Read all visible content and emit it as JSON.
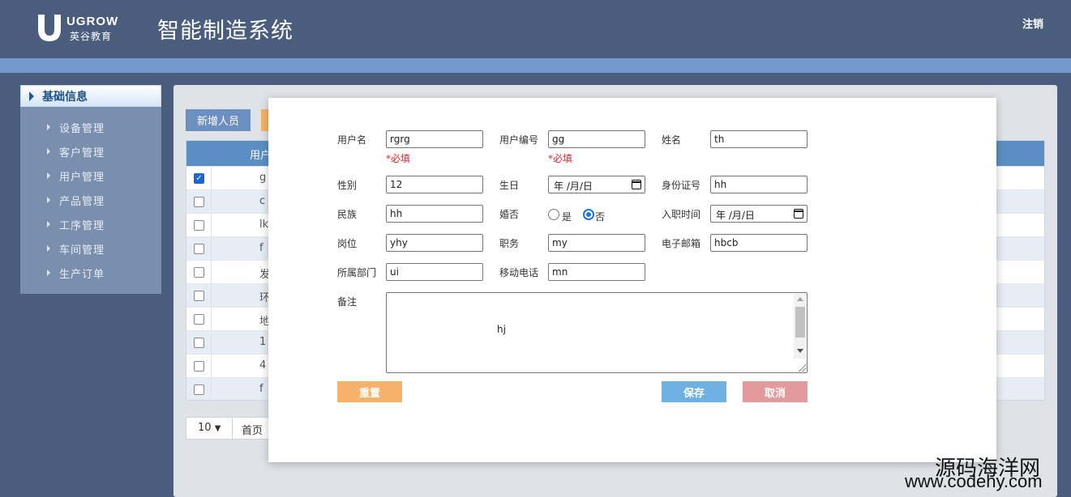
{
  "header": {
    "logo_en": "UGROW",
    "logo_cn": "英谷教育",
    "title": "智能制造系统",
    "logout": "注销"
  },
  "sidebar": {
    "group_label": "基础信息",
    "items": [
      {
        "label": "设备管理"
      },
      {
        "label": "客户管理"
      },
      {
        "label": "用户管理"
      },
      {
        "label": "产品管理"
      },
      {
        "label": "工序管理"
      },
      {
        "label": "车间管理"
      },
      {
        "label": "生产订单"
      }
    ]
  },
  "main": {
    "add_button": "新增人员",
    "table_header": "用户",
    "rows": [
      {
        "checked": true,
        "text": "g"
      },
      {
        "checked": false,
        "text": "c"
      },
      {
        "checked": false,
        "text": "lk"
      },
      {
        "checked": false,
        "text": "f"
      },
      {
        "checked": false,
        "text": "发"
      },
      {
        "checked": false,
        "text": "环"
      },
      {
        "checked": false,
        "text": "地"
      },
      {
        "checked": false,
        "text": "1"
      },
      {
        "checked": false,
        "text": "4"
      },
      {
        "checked": false,
        "text": "f"
      }
    ],
    "pager": {
      "page_size": "10",
      "first": "首页"
    }
  },
  "modal": {
    "labels": {
      "username": "用户名",
      "user_no": "用户编号",
      "name": "姓名",
      "gender": "性别",
      "birthday": "生日",
      "id_card": "身份证号",
      "ethnicity": "民族",
      "marital": "婚否",
      "hire_date": "入职时间",
      "post": "岗位",
      "duty": "职务",
      "email": "电子邮箱",
      "department": "所属部门",
      "mobile": "移动电话",
      "remark": "备注"
    },
    "values": {
      "username": "rgrg",
      "user_no": "gg",
      "name": "th",
      "gender": "12",
      "birthday": "年 /月/日",
      "id_card": "hh",
      "ethnicity": "hh",
      "hire_date": "年 /月/日",
      "post": "yhy",
      "duty": "my",
      "email": "hbcb",
      "department": "ui",
      "mobile": "mn",
      "remark": "hj"
    },
    "required_hint": "*必填",
    "marital_options": {
      "yes": "是",
      "no": "否",
      "selected": "no"
    },
    "buttons": {
      "reset": "重置",
      "save": "保存",
      "cancel": "取消"
    },
    "colors": {
      "reset": "#f6b26b",
      "save": "#6fb0e3",
      "cancel": "#e39a9c",
      "required": "#d9232b"
    }
  },
  "watermark": {
    "cn": "源码海洋网",
    "url": "www.codehy.com"
  }
}
